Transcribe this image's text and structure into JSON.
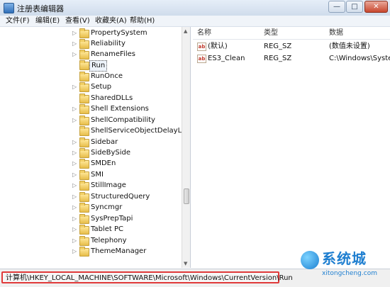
{
  "window": {
    "title": "注册表编辑器",
    "minimize_glyph": "—",
    "maximize_glyph": "□",
    "close_glyph": "✕"
  },
  "menu": [
    "文件(F)",
    "编辑(E)",
    "查看(V)",
    "收藏夹(A)",
    "帮助(H)"
  ],
  "tree": {
    "items": [
      {
        "label": "PropertySystem",
        "expander": "▷"
      },
      {
        "label": "Reliability",
        "expander": "▷"
      },
      {
        "label": "RenameFiles",
        "expander": "▷"
      },
      {
        "label": "Run",
        "expander": "",
        "selected": true
      },
      {
        "label": "RunOnce",
        "expander": ""
      },
      {
        "label": "Setup",
        "expander": "▷"
      },
      {
        "label": "SharedDLLs",
        "expander": ""
      },
      {
        "label": "Shell Extensions",
        "expander": "▷"
      },
      {
        "label": "ShellCompatibility",
        "expander": "▷"
      },
      {
        "label": "ShellServiceObjectDelayLoad",
        "expander": ""
      },
      {
        "label": "Sidebar",
        "expander": "▷"
      },
      {
        "label": "SideBySide",
        "expander": "▷"
      },
      {
        "label": "SMDEn",
        "expander": "▷"
      },
      {
        "label": "SMI",
        "expander": "▷"
      },
      {
        "label": "StillImage",
        "expander": "▷"
      },
      {
        "label": "StructuredQuery",
        "expander": "▷"
      },
      {
        "label": "Syncmgr",
        "expander": "▷"
      },
      {
        "label": "SysPrepTapi",
        "expander": "▷"
      },
      {
        "label": "Tablet PC",
        "expander": "▷"
      },
      {
        "label": "Telephony",
        "expander": "▷"
      },
      {
        "label": "ThemeManager",
        "expander": "▷"
      }
    ]
  },
  "values": {
    "headers": {
      "name": "名称",
      "type": "类型",
      "data": "数据"
    },
    "icon_text": "ab",
    "rows": [
      {
        "name": "(默认)",
        "type": "REG_SZ",
        "data": "(数值未设置)"
      },
      {
        "name": "ES3_Clean",
        "type": "REG_SZ",
        "data": "C:\\Windows\\Syste"
      }
    ]
  },
  "status": {
    "path": "计算机\\HKEY_LOCAL_MACHINE\\SOFTWARE\\Microsoft\\Windows\\CurrentVersion\\Run"
  },
  "watermark": {
    "cn": "系统城",
    "en": "xitongcheng.com"
  },
  "colors": {
    "highlight_border": "#e03a3a",
    "folder": "#e7be4a",
    "watermark": "#1f7fd0"
  }
}
